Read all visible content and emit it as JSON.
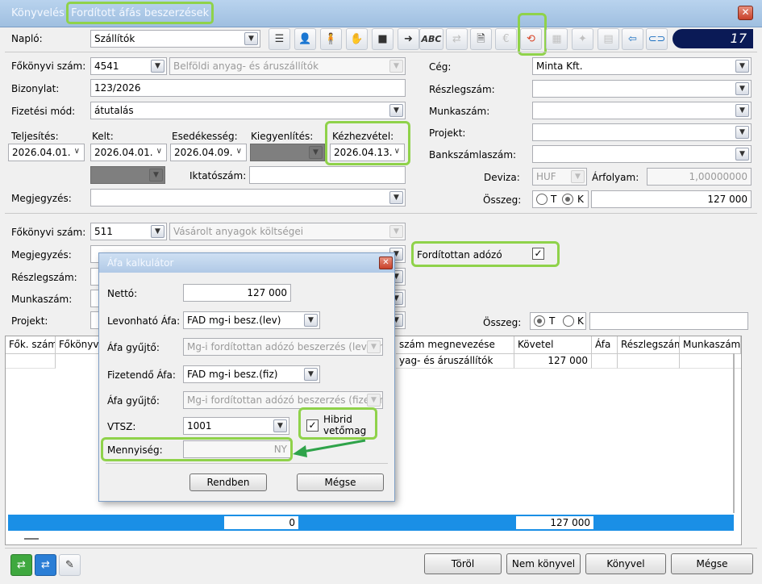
{
  "titlebar": {
    "app": "Könyvelés",
    "title": "Fordított áfás beszerzések",
    "close": "✕"
  },
  "toolbar": {
    "naplo_label": "Napló:",
    "naplo_value": "Szállítók",
    "counter": "17",
    "icons": [
      "list-icon",
      "user-icon",
      "person-icon",
      "money-hand-icon",
      "box-icon",
      "arrow-icon",
      "abc",
      "exchange-icon",
      "person-doc-icon",
      "euro",
      "reverse-vat-icon",
      "grid-icon",
      "stamp-icon",
      "table-icon",
      "import-icon",
      "link-icon"
    ]
  },
  "form": {
    "fokonyv_label": "Főkönyvi szám:",
    "fokonyv_value": "4541",
    "fokonyv_name": "Belföldi anyag- és áruszállítók",
    "bizonylat_label": "Bizonylat:",
    "bizonylat_value": "123/2026",
    "fizmod_label": "Fizetési mód:",
    "fizmod_value": "átutalás",
    "teljesites_label": "Teljesítés:",
    "teljesites_value": "2026.04.01.",
    "kelt_label": "Kelt:",
    "kelt_value": "2026.04.01.",
    "esedekesseg_label": "Esedékesség:",
    "esedekesseg_value": "2026.04.09.",
    "kiegyenlites_label": "Kiegyenlítés:",
    "kezhezvetel_label": "Kézhezvétel:",
    "kezhezvetel_value": "2026.04.13.",
    "iktatoszam_label": "Iktatószám:",
    "megjegyzes_label": "Megjegyzés:",
    "ceg_label": "Cég:",
    "ceg_value": "Minta Kft.",
    "reszleg_label": "Részlegszám:",
    "munkaszam_label": "Munkaszám:",
    "projekt_label": "Projekt:",
    "bankszamla_label": "Bankszámlaszám:",
    "deviza_label": "Deviza:",
    "deviza_value": "HUF",
    "arfolyam_label": "Árfolyam:",
    "arfolyam_value": "1,00000000",
    "osszeg_label": "Összeg:",
    "osszeg_value": "127 000",
    "t": "T",
    "k": "K"
  },
  "tetel": {
    "fokonyv_label": "Főkönyvi szám:",
    "fokonyv_value": "511",
    "fokonyv_name": "Vásárolt anyagok költségei",
    "megjegyzes_label": "Megjegyzés:",
    "reszleg_label": "Részlegszám:",
    "munkaszam_label": "Munkaszám:",
    "projekt_label": "Projekt:",
    "forditott_label": "Fordítottan adózó",
    "forditott_checked": "✓",
    "osszeg_label": "Összeg:",
    "t": "T",
    "k": "K"
  },
  "grid": {
    "columns": [
      "Fők. szám",
      "Főkönyv",
      "szám megnevezése",
      "Követel",
      "Áfa",
      "Részlegszám",
      "Munkaszám"
    ],
    "row": {
      "megnevezes": "yag- és áruszállítók",
      "kovetel": "127 000"
    },
    "totals": {
      "tartozik": "0",
      "kovetel": "127 000"
    }
  },
  "dialog": {
    "title": "Áfa kalkulátor",
    "close": "✕",
    "netto_label": "Nettó:",
    "netto_value": "127 000",
    "levonhato_label": "Levonható Áfa:",
    "levonhato_value": "FAD mg-i besz.(lev)",
    "gyujto1_label": "Áfa gyűjtő:",
    "gyujto1_value": "Mg-i fordítottan adózó beszerzés (levonh",
    "fizetendo_label": "Fizetendő Áfa:",
    "fizetendo_value": "FAD mg-i besz.(fiz)",
    "gyujto2_label": "Áfa gyűjtő:",
    "gyujto2_value": "Mg-i fordítottan adózó beszerzés (fizeten",
    "vtsz_label": "VTSZ:",
    "vtsz_value": "1001",
    "hibrid_label1": "Hibrid",
    "hibrid_label2": "vetőmag",
    "hibrid_checked": "✓",
    "mennyiseg_label": "Mennyiség:",
    "mennyiseg_unit": "NY",
    "ok": "Rendben",
    "cancel": "Mégse"
  },
  "footer": {
    "torol": "Töröl",
    "nem_konyvel": "Nem könyvel",
    "konyvel": "Könyvel",
    "megse": "Mégse"
  },
  "colors": {
    "highlight": "#8fd24a",
    "arrow": "#2fa34a",
    "totals_bar": "#1a8fe6"
  }
}
